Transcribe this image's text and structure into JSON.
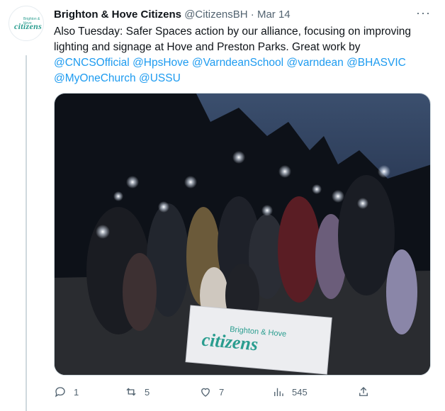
{
  "tweet": {
    "author_name": "Brighton & Hove Citizens",
    "handle": "@CitizensBH",
    "separator": "·",
    "date": "Mar 14",
    "more_label": "···",
    "avatar": {
      "top": "Brighton & Hove",
      "main": "citizens"
    },
    "text_intro": "Also Tuesday: Safer Spaces action by our alliance, focusing on improving lighting and signage at Hove and Preston Parks. Great work by ",
    "mentions": [
      "@CNCSOfficial",
      "@HpsHove",
      "@VarndeanSchool",
      "@varndean",
      "@BHASVIC",
      "@MyOneChurch",
      "@USSU"
    ],
    "banner": {
      "top": "Brighton & Hove",
      "main": "citizens"
    }
  },
  "actions": {
    "replies": "1",
    "retweets": "5",
    "likes": "7",
    "views": "545"
  },
  "icons": [
    "reply-icon",
    "retweet-icon",
    "like-icon",
    "views-icon",
    "share-icon"
  ],
  "colors": {
    "accent": "#1d9bf0",
    "brand": "#2a9d8f",
    "muted": "#536471"
  }
}
